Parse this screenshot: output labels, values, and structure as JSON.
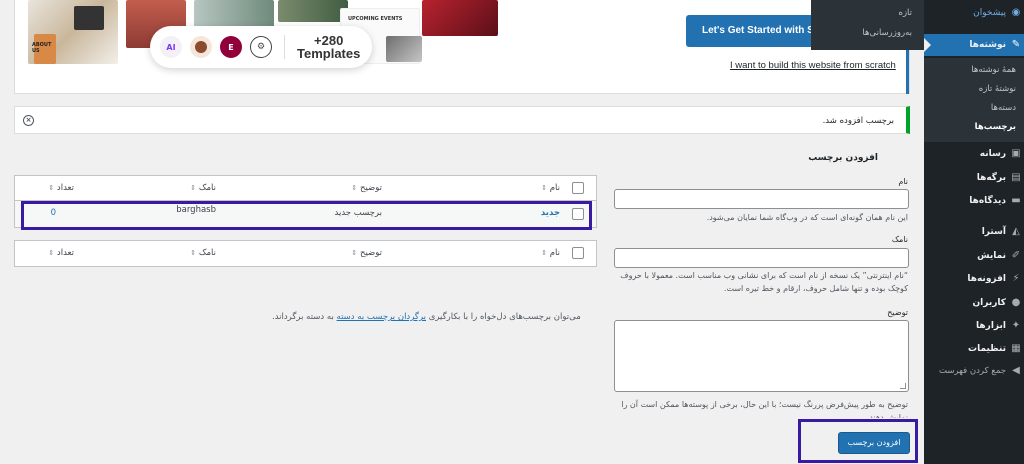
{
  "banner": {
    "templates_count": "+280",
    "templates_label": "Templates",
    "ai_label": "AI",
    "elementor_label": "E",
    "get_started_label": "Let's Get Started with Sta",
    "scratch_link": "I want to build this website from scratch",
    "thumb_text_about": "ABOUT US",
    "thumb_text_events": "UPCOMING EVENTS"
  },
  "dropdown": {
    "items": [
      "تازه",
      "به‌روزرسانی‌ها"
    ]
  },
  "notice": {
    "text": "برچسب افزوده شد."
  },
  "form": {
    "title": "افزودن برچسب",
    "name_label": "نام",
    "name_help": "این نام همان گونه‌ای است که در وب‌گاه شما نمایان می‌شود.",
    "slug_label": "نامک",
    "slug_help": "“نام اینترنتی” یک نسخه از نام است که برای نشانی وب مناسب است. معمولا با حروف کوچک بوده و تنها شامل حروف، ارقام و خط تیره است.",
    "description_label": "توضیح",
    "description_help": "توضیح به طور پیش‌فرض پررنگ نیست؛ با این حال، برخی از پوسته‌ها ممکن است آن را نمایش دهند.",
    "submit_label": "افزودن برچسب"
  },
  "table": {
    "columns": {
      "name": "نام",
      "description": "توضیح",
      "slug": "نامک",
      "count": "تعداد"
    },
    "rows": [
      {
        "name": "جدید",
        "description": "برچسب جدید",
        "slug": "barghasb",
        "count": "0"
      }
    ]
  },
  "footer_note": {
    "before": "می‌توان برچسب‌های دل‌خواه را با بکارگیری",
    "link": "برگردان برچسب به دسته",
    "after": "به دسته برگرداند."
  },
  "sidebar": {
    "dashboard": "پیشخوان",
    "posts": "نوشته‌ها",
    "posts_sub": [
      "همهٔ نوشته‌ها",
      "نوشتهٔ تازه",
      "دسته‌ها",
      "برچسب‌ها"
    ],
    "media": "رسانه",
    "pages": "برگه‌ها",
    "comments": "دیدگاه‌ها",
    "astra": "آسترا",
    "appearance": "نمایش",
    "plugins": "افزونه‌ها",
    "users": "کاربران",
    "tools": "ابزارها",
    "settings": "تنظیمات",
    "collapse": "جمع کردن فهرست"
  },
  "colors": {
    "primary": "#2271b1",
    "sidebar_bg": "#1d2327",
    "success": "#00a32a",
    "highlight": "#3b1aa3"
  }
}
